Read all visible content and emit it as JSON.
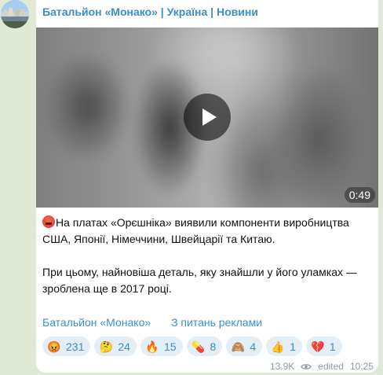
{
  "channel": {
    "title": "Батальйон «Монако» | Україна | Новини"
  },
  "video": {
    "duration": "0:49",
    "play_icon": "play-icon"
  },
  "message": {
    "lead_emoji": "rage-face-icon",
    "paragraph_1": "На платах «Орєшніка» виявили компоненти виробництва США, Японії, Німеччини, Швейцарії та Китаю.",
    "paragraph_2": "При цьому, найновіша деталь, яку знайшли у його уламках — зроблена ще в 2017 році."
  },
  "links": {
    "channel_link": "Батальйон «Монако»",
    "ads_link": "З питань реклами"
  },
  "reactions": [
    {
      "icon": "rage-face-icon",
      "glyph": "😡",
      "count": "231"
    },
    {
      "icon": "thinking-face-icon",
      "glyph": "🤔",
      "count": "24"
    },
    {
      "icon": "fire-icon",
      "glyph": "🔥",
      "count": "15"
    },
    {
      "icon": "pill-icon",
      "glyph": "💊",
      "count": "8"
    },
    {
      "icon": "see-no-evil-monkey-icon",
      "glyph": "🙈",
      "count": "4"
    },
    {
      "icon": "thumbs-up-icon",
      "glyph": "👍",
      "count": "1"
    },
    {
      "icon": "broken-heart-icon",
      "glyph": "💔",
      "count": "1"
    }
  ],
  "meta": {
    "views": "13.9K",
    "edited_label": "edited",
    "time": "10:25"
  },
  "colors": {
    "background": "#dfe9d6",
    "accent": "#3a8fc8",
    "reaction_bg": "#e4eef7",
    "meta_text": "#8c9aa6"
  }
}
